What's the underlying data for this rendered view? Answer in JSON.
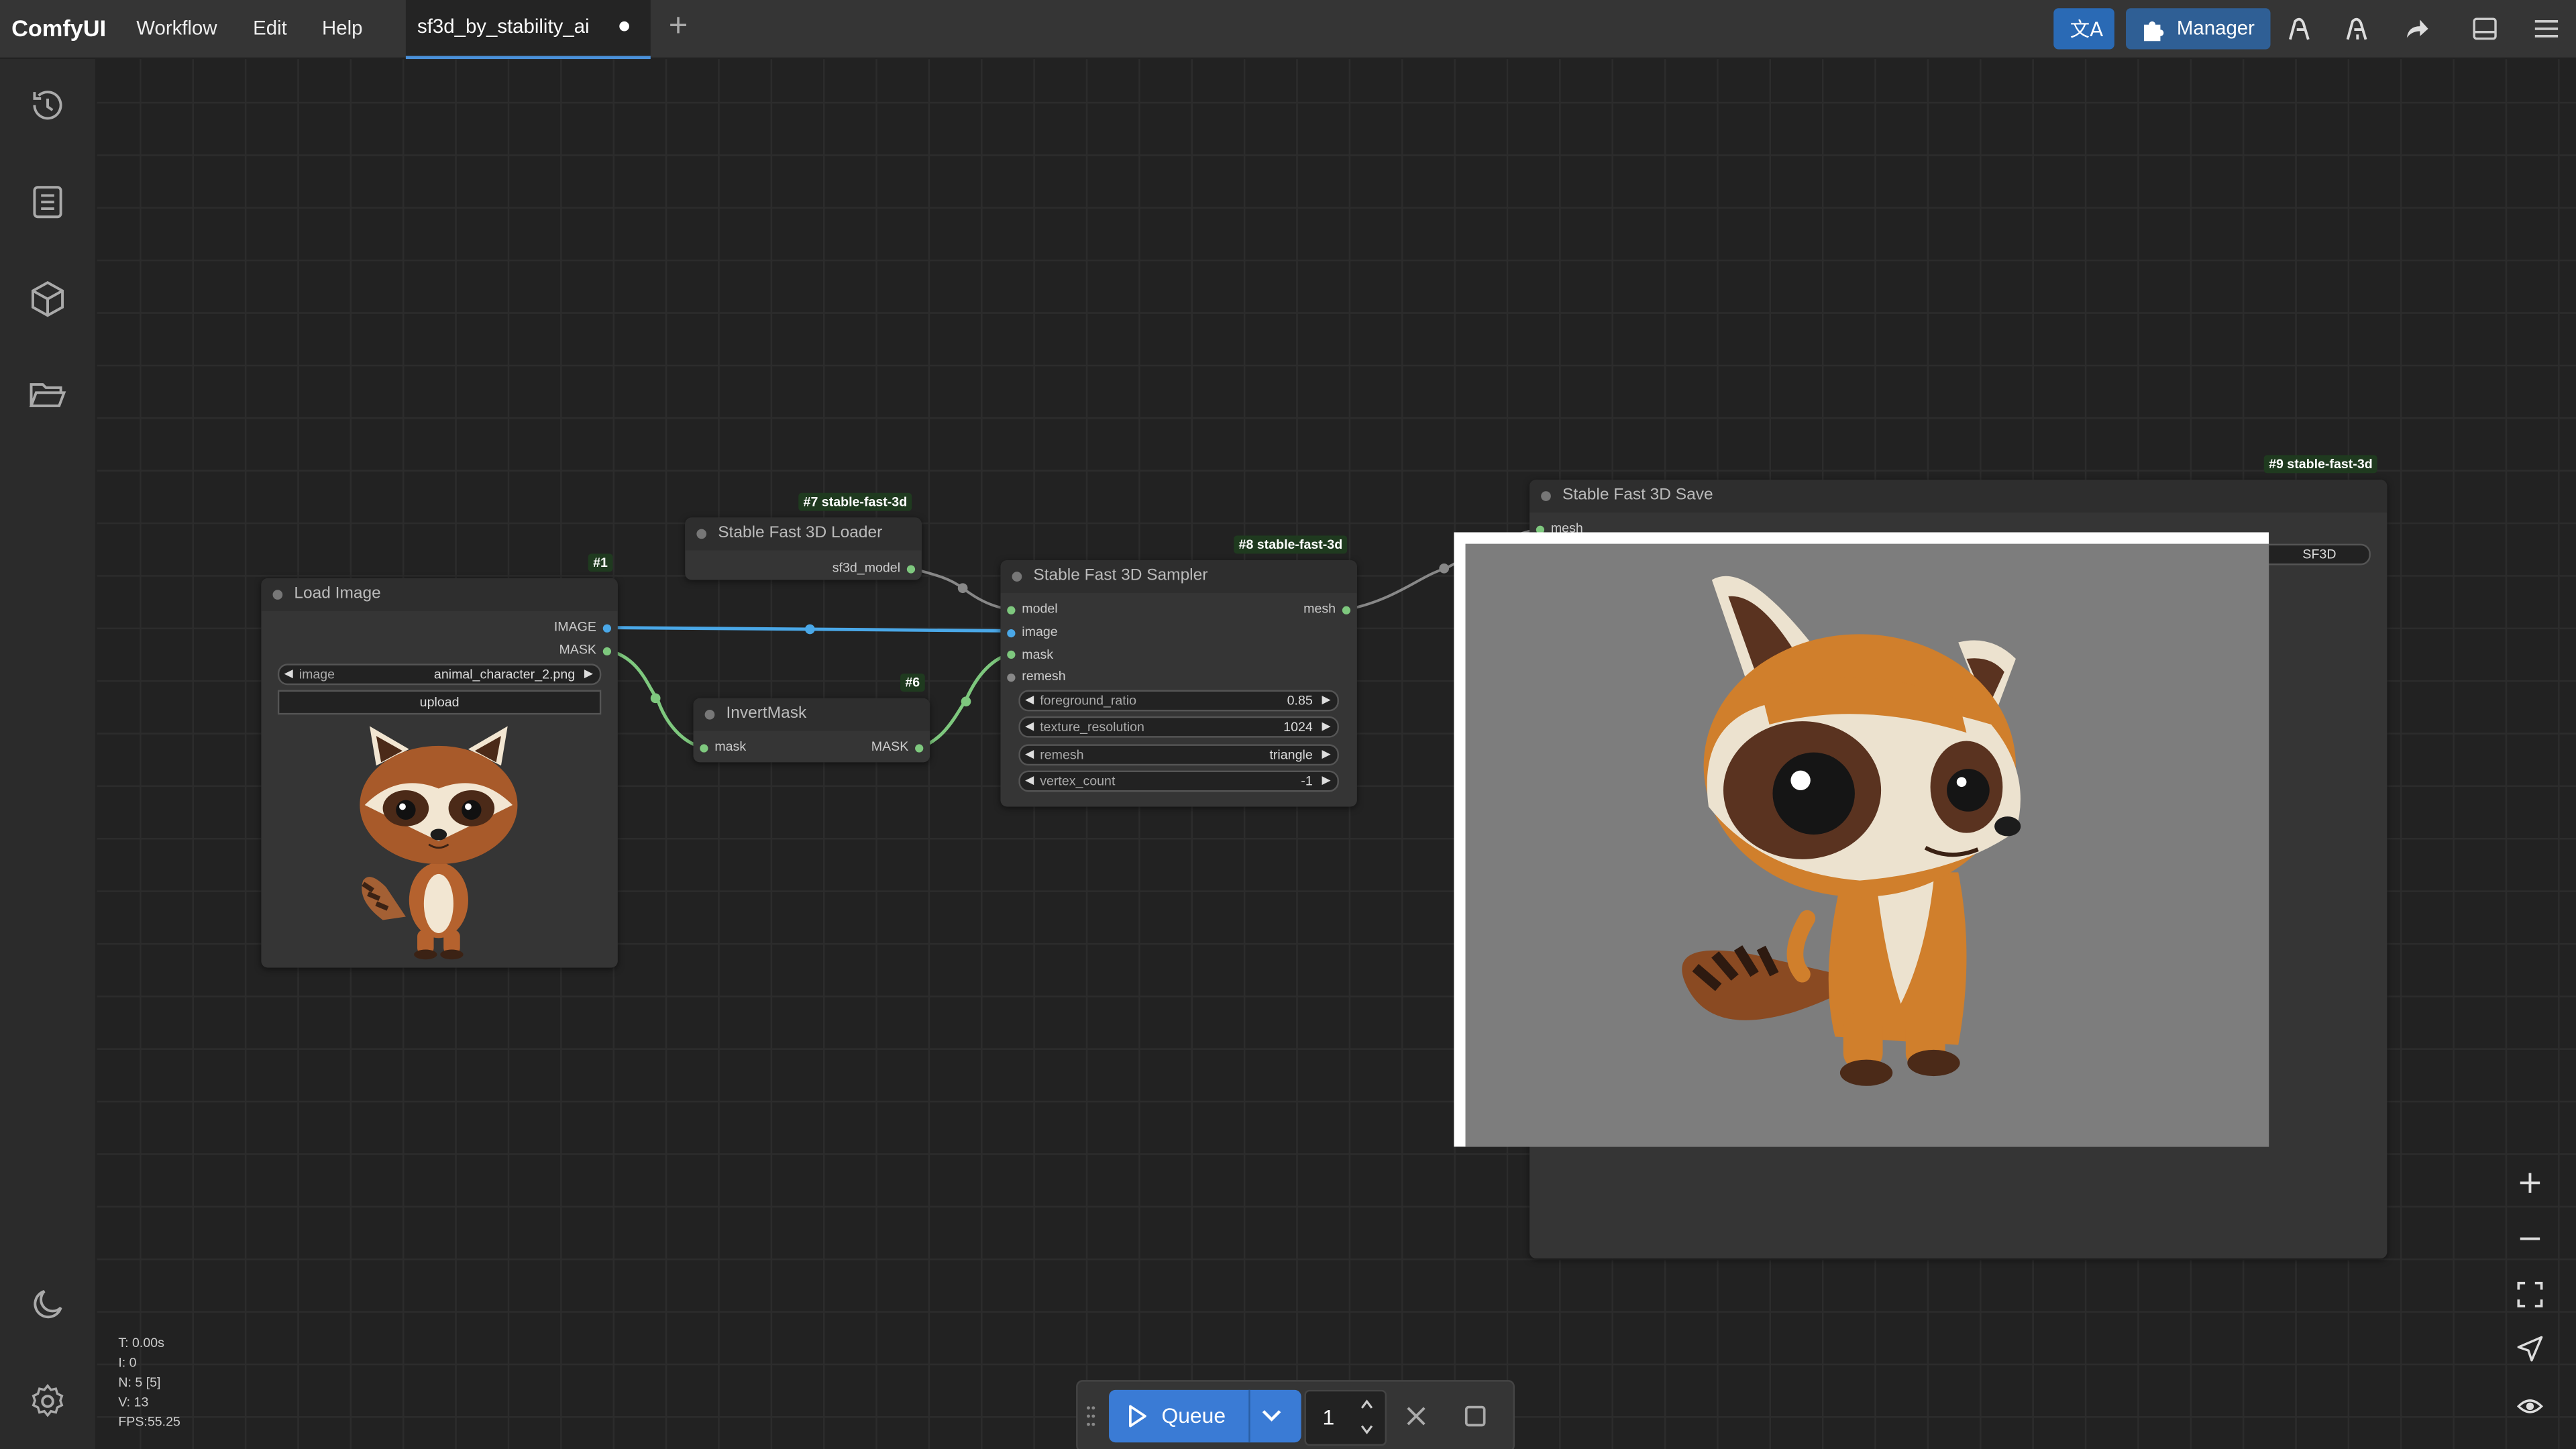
{
  "app": {
    "name": "ComfyUI"
  },
  "menu": {
    "workflow": "Workflow",
    "edit": "Edit",
    "help": "Help"
  },
  "tabs": [
    {
      "label": "sf3d_by_stability_ai"
    }
  ],
  "toolbar": {
    "manager_label": "Manager"
  },
  "nodes": {
    "load_image": {
      "badge": "#1",
      "title": "Load Image",
      "outputs": [
        "IMAGE",
        "MASK"
      ],
      "widget_image": {
        "label": "image",
        "value": "animal_character_2.png"
      },
      "upload_label": "upload"
    },
    "loader": {
      "badge": "#7 stable-fast-3d",
      "title": "Stable Fast 3D Loader",
      "output": "sf3d_model"
    },
    "invert": {
      "badge": "#6",
      "title": "InvertMask",
      "input": "mask",
      "output": "MASK"
    },
    "sampler": {
      "badge": "#8 stable-fast-3d",
      "title": "Stable Fast 3D Sampler",
      "inputs": [
        "model",
        "image",
        "mask",
        "remesh"
      ],
      "output": "mesh",
      "widgets": [
        {
          "label": "foreground_ratio",
          "value": "0.85"
        },
        {
          "label": "texture_resolution",
          "value": "1024"
        },
        {
          "label": "remesh",
          "value": "triangle"
        },
        {
          "label": "vertex_count",
          "value": "-1"
        }
      ]
    },
    "save": {
      "badge": "#9 stable-fast-3d",
      "title": "Stable Fast 3D Save",
      "input": "mesh",
      "widget_value": "SF3D"
    }
  },
  "stats": {
    "t": "T: 0.00s",
    "i": "I: 0",
    "n": "N: 5 [5]",
    "v": "V: 13",
    "fps": "FPS:55.25"
  },
  "queue": {
    "label": "Queue",
    "count": "1"
  },
  "colors": {
    "accent": "#3a7bd5",
    "manager": "#2f5f95",
    "translate": "#2a6ab5",
    "image_link": "#4aa8e8",
    "mask_link": "#7ec87e"
  }
}
